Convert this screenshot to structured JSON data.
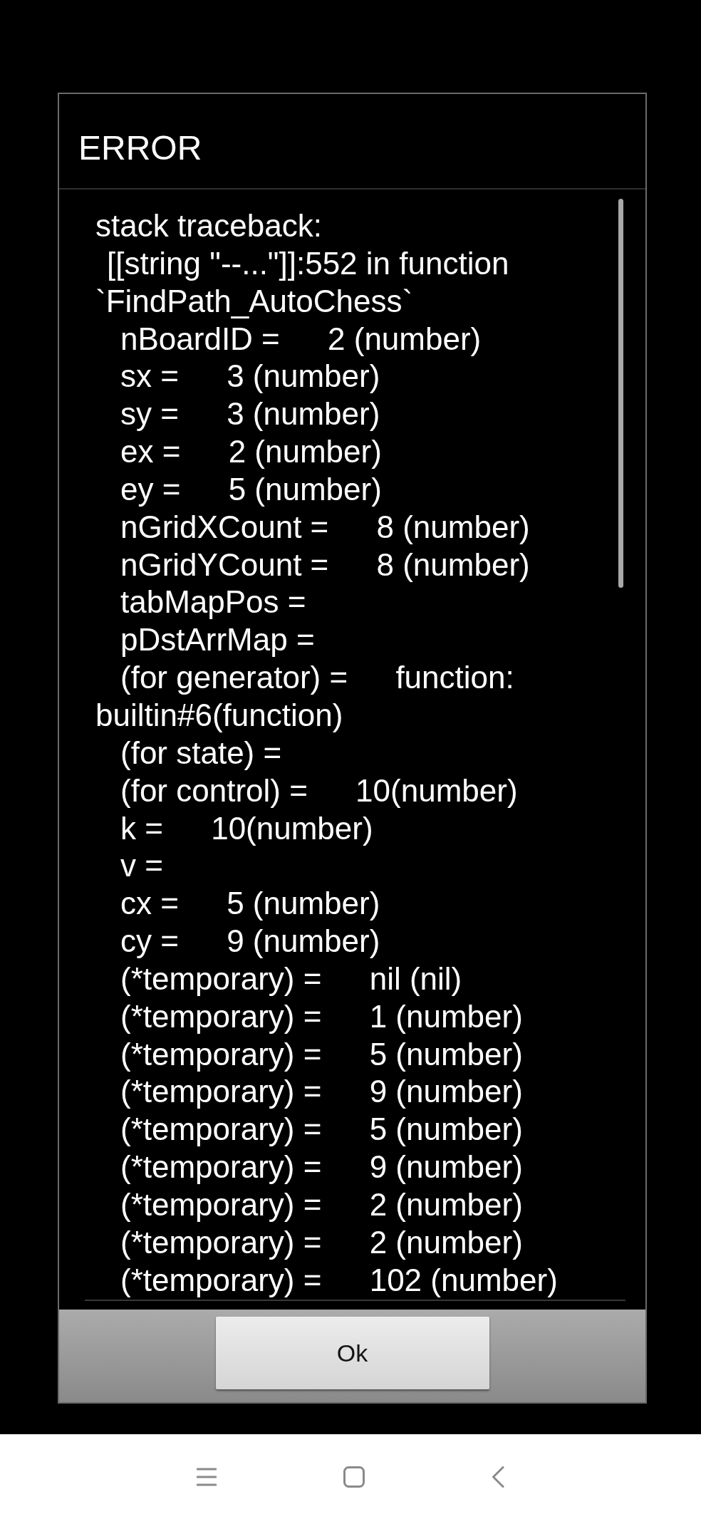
{
  "dialog": {
    "title": "ERROR",
    "traceback": [
      {
        "kind": "heading",
        "text": "stack traceback:"
      },
      {
        "kind": "frame",
        "text": "[[string \"--...\"]]:552 in function `FindPath_AutoChess`"
      },
      {
        "kind": "local",
        "name": "nBoardID =",
        "value": "2 (number)"
      },
      {
        "kind": "local",
        "name": "sx =",
        "value": "3 (number)"
      },
      {
        "kind": "local",
        "name": "sy =",
        "value": "3 (number)"
      },
      {
        "kind": "local",
        "name": "ex =",
        "value": "2 (number)"
      },
      {
        "kind": "local",
        "name": "ey =",
        "value": "5 (number)"
      },
      {
        "kind": "local",
        "name": "nGridXCount =",
        "value": "8 (number)"
      },
      {
        "kind": "local",
        "name": "nGridYCount =",
        "value": "8 (number)"
      },
      {
        "kind": "local",
        "name": "tabMapPos ="
      },
      {
        "kind": "local",
        "name": "pDstArrMap ="
      },
      {
        "kind": "local",
        "name": "(for generator) =",
        "value": "function: builtin#6(function)"
      },
      {
        "kind": "local",
        "name": "(for state) ="
      },
      {
        "kind": "local",
        "name": "(for control) =",
        "value": "10(number)"
      },
      {
        "kind": "local",
        "name": "k =",
        "value": "10(number)"
      },
      {
        "kind": "local",
        "name": "v ="
      },
      {
        "kind": "local",
        "name": "cx =",
        "value": "5 (number)"
      },
      {
        "kind": "local",
        "name": "cy =",
        "value": "9 (number)"
      },
      {
        "kind": "local",
        "name": "(*temporary) =",
        "value": "nil (nil)"
      },
      {
        "kind": "local",
        "name": "(*temporary) =",
        "value": "1 (number)"
      },
      {
        "kind": "local",
        "name": "(*temporary) =",
        "value": "5 (number)"
      },
      {
        "kind": "local",
        "name": "(*temporary) =",
        "value": "9 (number)"
      },
      {
        "kind": "local",
        "name": "(*temporary) =",
        "value": "5 (number)"
      },
      {
        "kind": "local",
        "name": "(*temporary) =",
        "value": "9 (number)"
      },
      {
        "kind": "local",
        "name": "(*temporary) =",
        "value": "2 (number)"
      },
      {
        "kind": "local",
        "name": "(*temporary) =",
        "value": "2 (number)"
      },
      {
        "kind": "local",
        "name": "(*temporary) =",
        "value": "102 (number)"
      }
    ],
    "buttons": [
      {
        "label": "Ok"
      }
    ]
  }
}
